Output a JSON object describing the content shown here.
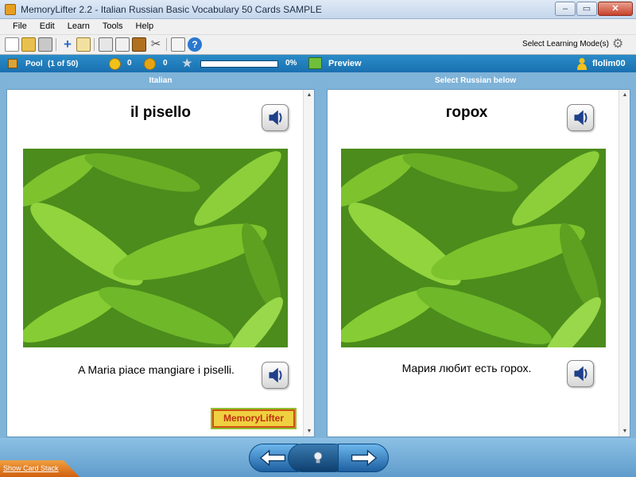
{
  "window": {
    "title": "MemoryLifter 2.2 - Italian Russian Basic Vocabulary 50 Cards SAMPLE",
    "minimize_label": "–",
    "maximize_label": "▭",
    "close_label": "✕"
  },
  "menu": {
    "items": [
      {
        "label": "File"
      },
      {
        "label": "Edit"
      },
      {
        "label": "Learn"
      },
      {
        "label": "Tools"
      },
      {
        "label": "Help"
      }
    ]
  },
  "toolbar": {
    "icons": [
      "new-file-icon",
      "open-folder-icon",
      "print-icon",
      "add-icon",
      "edit-icon",
      "statistics-icon",
      "print-preview-icon",
      "card-box-icon",
      "settings-tools-icon",
      "lock-icon",
      "help-icon"
    ],
    "mode_label": "Select Learning Mode(s)"
  },
  "status": {
    "pool_label": "Pool",
    "pool_count": "(1 of 50)",
    "happy_count": "0",
    "sad_count": "0",
    "progress_percent_label": "0%",
    "progress_fraction": 0,
    "preview_label": "Preview",
    "user_name": "flolim00"
  },
  "question": {
    "header": "Italian",
    "word": "il pisello",
    "sentence": "A Maria piace mangiare i piselli.",
    "logo_text": "MemoryLifter"
  },
  "answer": {
    "header": "Select Russian below",
    "word": "горох",
    "sentence": "Мария любит есть горох."
  },
  "footer": {
    "show_card_stack_label": "Show Card Stack"
  },
  "colors": {
    "accent_blue": "#1a70b0",
    "window_bg": "#7fb3d8",
    "pea_green": "#4a8a1a"
  }
}
